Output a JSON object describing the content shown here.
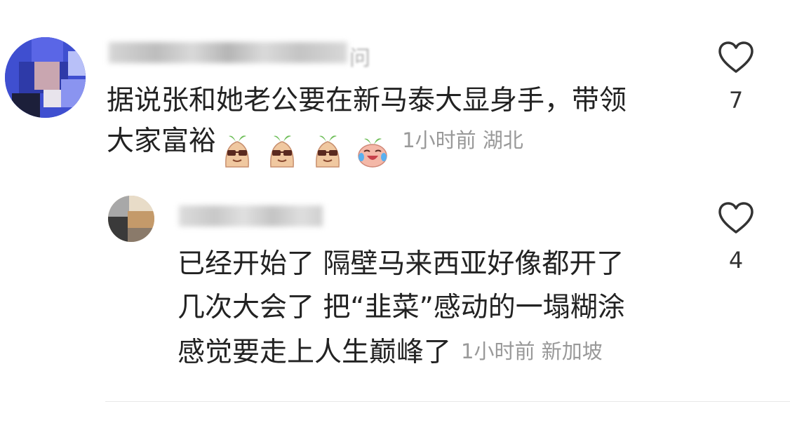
{
  "comments": [
    {
      "text_line1": "据说张和她老公要在新马泰大显身手，带领",
      "text_line2": "大家富裕",
      "emojis": [
        "sunglasses-sprout-emoji",
        "sunglasses-sprout-emoji",
        "sunglasses-sprout-emoji",
        "tears-of-joy-sprout-emoji"
      ],
      "time": "1小时前",
      "location": "湖北",
      "likes": "7",
      "username_tail": "问"
    }
  ],
  "reply": {
    "text_line1": "已经开始了 隔壁马来西亚好像都开了",
    "text_line2": "几次大会了 把“韭菜”感动的一塌糊涂",
    "text_line3": "感觉要走上人生巅峰了",
    "time": "1小时前",
    "location": "新加坡",
    "likes": "4"
  },
  "colors": {
    "text": "#222222",
    "meta": "#999999",
    "icon": "#333333",
    "divider": "#e8e8e8"
  }
}
